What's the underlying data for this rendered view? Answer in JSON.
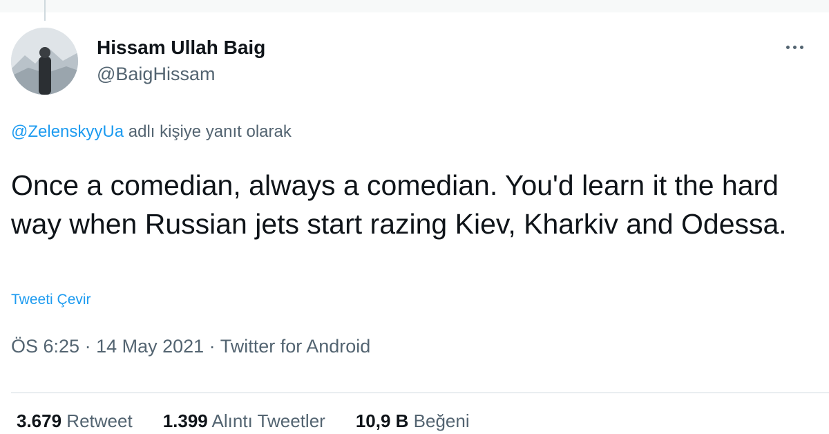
{
  "author": {
    "display_name": "Hissam Ullah Baig",
    "handle": "@BaigHissam"
  },
  "reply_context": {
    "mention": "@ZelenskyyUa",
    "suffix": " adlı kişiye yanıt olarak"
  },
  "tweet": {
    "text": "Once a comedian, always a comedian. You'd learn it the hard way when Russian jets start razing Kiev, Kharkiv and Odessa.",
    "translate_label": "Tweeti Çevir"
  },
  "meta": {
    "time": "ÖS 6:25",
    "separator": " · ",
    "date": "14 May 2021",
    "source": "Twitter for Android"
  },
  "stats": {
    "retweets": {
      "count": "3.679",
      "label": " Retweet"
    },
    "quotes": {
      "count": "1.399",
      "label": " Alıntı Tweetler"
    },
    "likes": {
      "count": "10,9 B",
      "label": " Beğeni"
    }
  },
  "icons": {
    "more": "more-horizontal-icon",
    "avatar": "profile-photo"
  },
  "colors": {
    "link": "#1d9bf0",
    "secondary_text": "#536471",
    "primary_text": "#0f1419"
  }
}
